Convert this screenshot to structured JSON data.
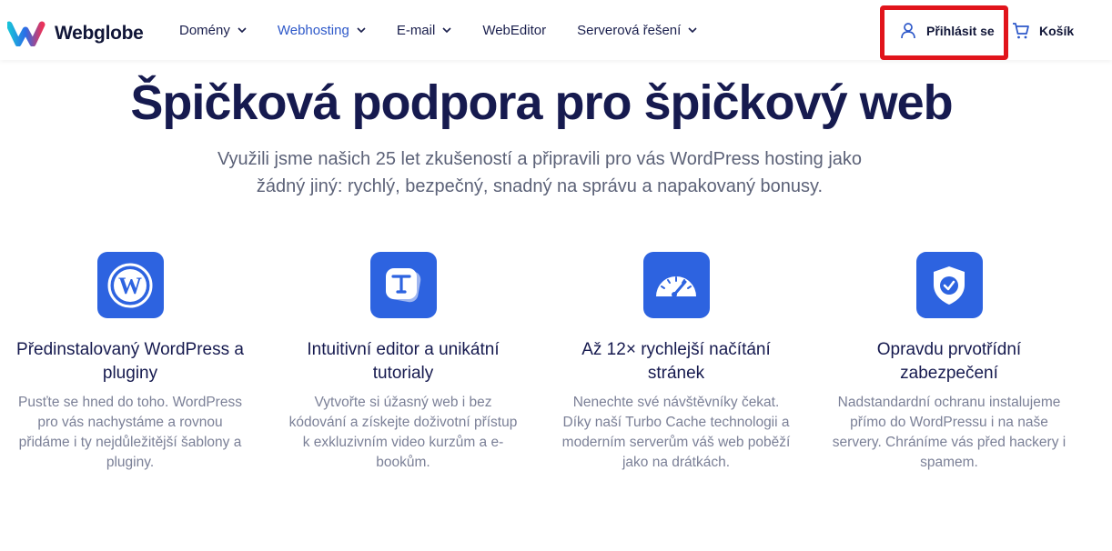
{
  "header": {
    "logo_text": "Webglobe",
    "nav": [
      {
        "label": "Domény",
        "has_dropdown": true,
        "active": false
      },
      {
        "label": "Webhosting",
        "has_dropdown": true,
        "active": true
      },
      {
        "label": "E-mail",
        "has_dropdown": true,
        "active": false
      },
      {
        "label": "WebEditor",
        "has_dropdown": false,
        "active": false
      },
      {
        "label": "Serverová řešení",
        "has_dropdown": true,
        "active": false
      }
    ],
    "login_label": "Přihlásit se",
    "cart_label": "Košík",
    "icons": {
      "login": "user-icon",
      "cart": "cart-icon"
    }
  },
  "hero": {
    "title": "Špičková podpora pro špičkový web",
    "subtitle": "Využili jsme našich 25 let zkušeností a připravili pro vás WordPress hosting jako žádný jiný: rychlý, bezpečný, snadný na správu a napakovaný bonusy."
  },
  "features": [
    {
      "icon": "wordpress-icon",
      "title": "Předinstalovaný WordPress a pluginy",
      "text": "Pusťte se hned do toho. WordPress pro vás nachystáme a rovnou přidáme i ty nejdůležitější šablony a pluginy."
    },
    {
      "icon": "text-editor-icon",
      "title": "Intuitivní editor a unikátní tutorialy",
      "text": "Vytvořte si úžasný web i bez kódování a získejte doživotní přístup k exkluzivním video kurzům a e-bookům."
    },
    {
      "icon": "speedometer-icon",
      "title": "Až 12× rychlejší načítání stránek",
      "text": "Nenechte své návštěvníky čekat. Díky naší Turbo Cache technologii a moderním serverům váš web poběží jako na drátkách."
    },
    {
      "icon": "shield-check-icon",
      "title": "Opravdu prvotřídní zabezpečení",
      "text": "Nadstandardní ochranu instalujeme přímo do WordPressu i na naše servery. Chráníme vás před hackery i spamem."
    }
  ],
  "colors": {
    "accent": "#2d63e0",
    "nav_active": "#2d58c9",
    "heading": "#161a4f",
    "body_text": "#7b8097",
    "highlight": "#e1141b"
  }
}
